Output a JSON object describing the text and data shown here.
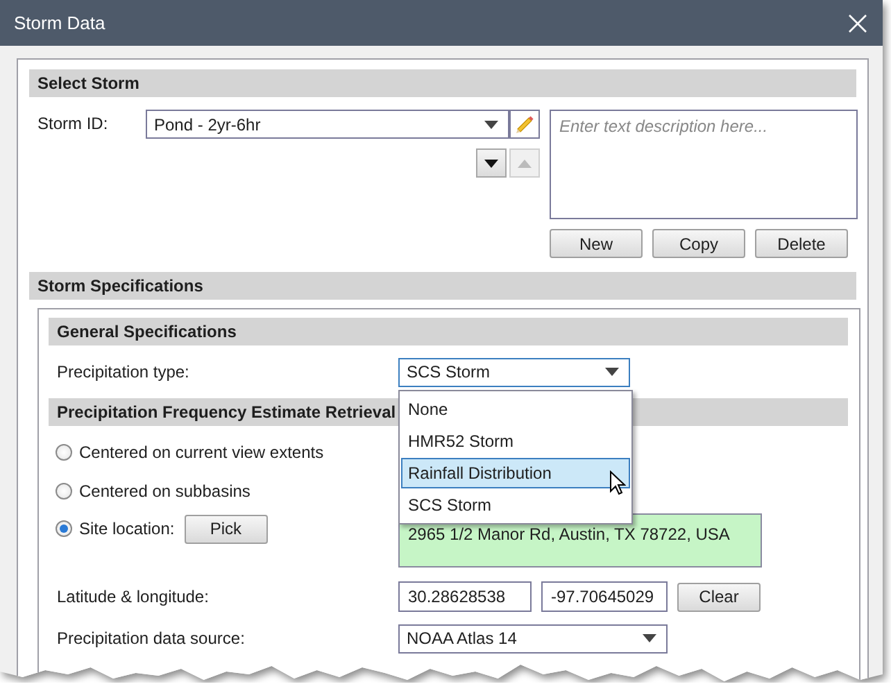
{
  "window": {
    "title": "Storm Data"
  },
  "select_storm": {
    "heading": "Select Storm",
    "storm_id": {
      "label": "Storm ID:",
      "value": "Pond - 2yr-6hr"
    },
    "description": {
      "placeholder": "Enter text description here..."
    },
    "buttons": [
      "New",
      "Copy",
      "Delete"
    ]
  },
  "storm_specifications": {
    "heading": "Storm Specifications",
    "general": {
      "heading": "General Specifications",
      "precipitation_type": {
        "label": "Precipitation type:",
        "value": "SCS Storm",
        "expanded": true,
        "options": [
          {
            "label": "None",
            "highlighted": false
          },
          {
            "label": "HMR52 Storm",
            "highlighted": false
          },
          {
            "label": "Rainfall Distribution",
            "highlighted": true
          },
          {
            "label": "SCS Storm",
            "highlighted": false
          }
        ]
      }
    },
    "retrieval": {
      "heading": "Precipitation Frequency Estimate Retrieval",
      "options": [
        {
          "label": "Centered on current view extents",
          "selected": false
        },
        {
          "label": "Centered on subbasins",
          "selected": false
        },
        {
          "label": "Site location:",
          "selected": true
        }
      ],
      "pick_button": "Pick",
      "address": "2965 1/2 Manor Rd, Austin, TX 78722, USA",
      "lat_long": {
        "label": "Latitude & longitude:",
        "latitude": "30.28628538",
        "longitude": "-97.70645029",
        "clear_button": "Clear"
      },
      "data_source": {
        "label": "Precipitation data source:",
        "value": "NOAA Atlas 14"
      }
    }
  }
}
